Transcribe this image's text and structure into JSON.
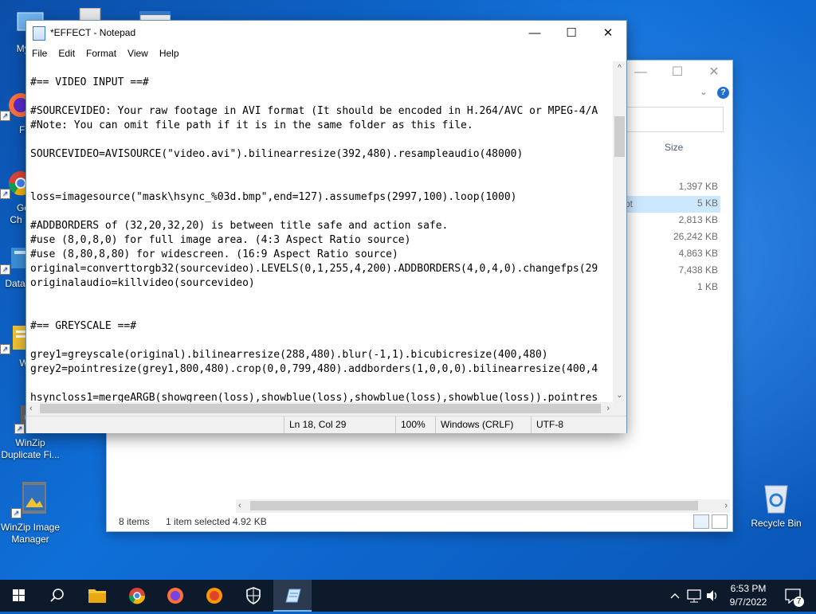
{
  "desktop_icons": [
    {
      "label": "My Co"
    },
    {
      "label": "Fi"
    },
    {
      "label": "Go Ch"
    },
    {
      "label": "DataV"
    },
    {
      "label": "W"
    },
    {
      "label": "WinZip Duplicate Fi..."
    },
    {
      "label": "WinZip Image Manager"
    },
    {
      "label": "Recycle Bin"
    }
  ],
  "explorer": {
    "size_header": "Size",
    "sizes": [
      "1,397 KB",
      "5 KB",
      "2,813 KB",
      "26,242 KB",
      "4,863 KB",
      "7,438 KB",
      "1 KB"
    ],
    "selected_row_fragment": "pt",
    "selected_index": 1,
    "status_items": "8 items",
    "status_selected": "1 item selected",
    "status_size": "4.92 KB"
  },
  "notepad": {
    "title": "*EFFECT - Notepad",
    "menu": [
      "File",
      "Edit",
      "Format",
      "View",
      "Help"
    ],
    "lines": [
      "#== VIDEO INPUT ==#",
      "",
      "#SOURCEVIDEO: Your raw footage in AVI format (It should be encoded in H.264/AVC or MPEG-4/A",
      "#Note: You can omit file path if it is in the same folder as this file.",
      "",
      "SOURCEVIDEO=AVISOURCE(\"video.avi\").bilinearresize(392,480).resampleaudio(48000)",
      "",
      "",
      "loss=imagesource(\"mask\\hsync_%03d.bmp\",end=127).assumefps(2997,100).loop(1000)",
      "",
      "#ADDBORDERS of (32,20,32,20) is between title safe and action safe.",
      "#use (8,0,8,0) for full image area. (4:3 Aspect Ratio source)",
      "#use (8,80,8,80) for widescreen. (16:9 Aspect Ratio source)",
      "original=converttorgb32(sourcevideo).LEVELS(0,1,255,4,200).ADDBORDERS(4,0,4,0).changefps(29",
      "originalaudio=killvideo(sourcevideo)",
      "",
      "",
      "#== GREYSCALE ==#",
      "",
      "grey1=greyscale(original).bilinearresize(288,480).blur(-1,1).bicubicresize(400,480)",
      "grey2=pointresize(grey1,800,480).crop(0,0,799,480).addborders(1,0,0,0).bilinearresize(400,4",
      "",
      "hsyncloss1=mergeARGB(showgreen(loss),showblue(loss),showblue(loss),showblue(loss)).pointres"
    ],
    "status": {
      "position": "Ln 18, Col 29",
      "zoom": "100%",
      "line_ending": "Windows (CRLF)",
      "encoding": "UTF-8"
    }
  },
  "taskbar": {
    "clock_time": "6:53 PM",
    "clock_date": "9/7/2022",
    "notification_count": "7"
  }
}
